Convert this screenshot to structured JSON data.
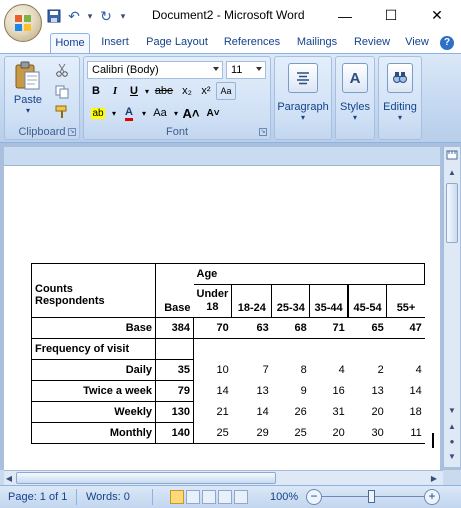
{
  "window": {
    "title": "Document2 - Microsoft Word",
    "minimize": "—",
    "maximize": "☐",
    "close": "✕"
  },
  "quick_access": {
    "save": "💾",
    "undo": "↶",
    "undo_dropdown": "▾",
    "redo": "↻",
    "customize": "▾"
  },
  "tabs": [
    "Home",
    "Insert",
    "Page Layout",
    "References",
    "Mailings",
    "Review",
    "View"
  ],
  "help": "?",
  "ribbon": {
    "clipboard": {
      "label": "Clipboard",
      "paste": "Paste",
      "paste_arrow": "▾"
    },
    "font": {
      "label": "Font",
      "font_name": "Calibri (Body)",
      "font_size": "11",
      "bold": "B",
      "italic": "I",
      "underline": "U",
      "strike": "abe",
      "subscript": "x₂",
      "superscript": "x²",
      "clear": "Aa",
      "grow": "A˄",
      "shrink": "A˅",
      "change_case": "Aa",
      "highlight": "ab",
      "font_color": "A"
    },
    "paragraph": {
      "label": "Paragraph"
    },
    "styles": {
      "label": "Styles"
    },
    "editing": {
      "label": "Editing"
    }
  },
  "table": {
    "header": {
      "counts": "Counts",
      "respondents": "Respondents",
      "age": "Age",
      "base": "Base",
      "under18_a": "Under",
      "under18_b": "18",
      "c1824": "18-24",
      "c2534": "25-34",
      "c3544": "35-44",
      "c4554": "45-54",
      "c55": "55+"
    },
    "base_row": {
      "label": "Base",
      "values": [
        "384",
        "70",
        "63",
        "68",
        "71",
        "65",
        "47"
      ]
    },
    "section": "Frequency of visit",
    "rows": [
      {
        "label": "Daily",
        "values": [
          "35",
          "10",
          "7",
          "8",
          "4",
          "2",
          "4"
        ]
      },
      {
        "label": "Twice a week",
        "values": [
          "79",
          "14",
          "13",
          "9",
          "16",
          "13",
          "14"
        ]
      },
      {
        "label": "Weekly",
        "values": [
          "130",
          "21",
          "14",
          "26",
          "31",
          "20",
          "18"
        ]
      },
      {
        "label": "Monthly",
        "values": [
          "140",
          "25",
          "29",
          "25",
          "20",
          "30",
          "11"
        ]
      }
    ]
  },
  "status": {
    "page": "Page: 1 of 1",
    "words": "Words: 0",
    "zoom": "100%",
    "zoom_out": "−",
    "zoom_in": "+"
  },
  "colors": {
    "ribbon": "#c4d8f1",
    "title_text": "#000000",
    "tab_text": "#15428b"
  }
}
